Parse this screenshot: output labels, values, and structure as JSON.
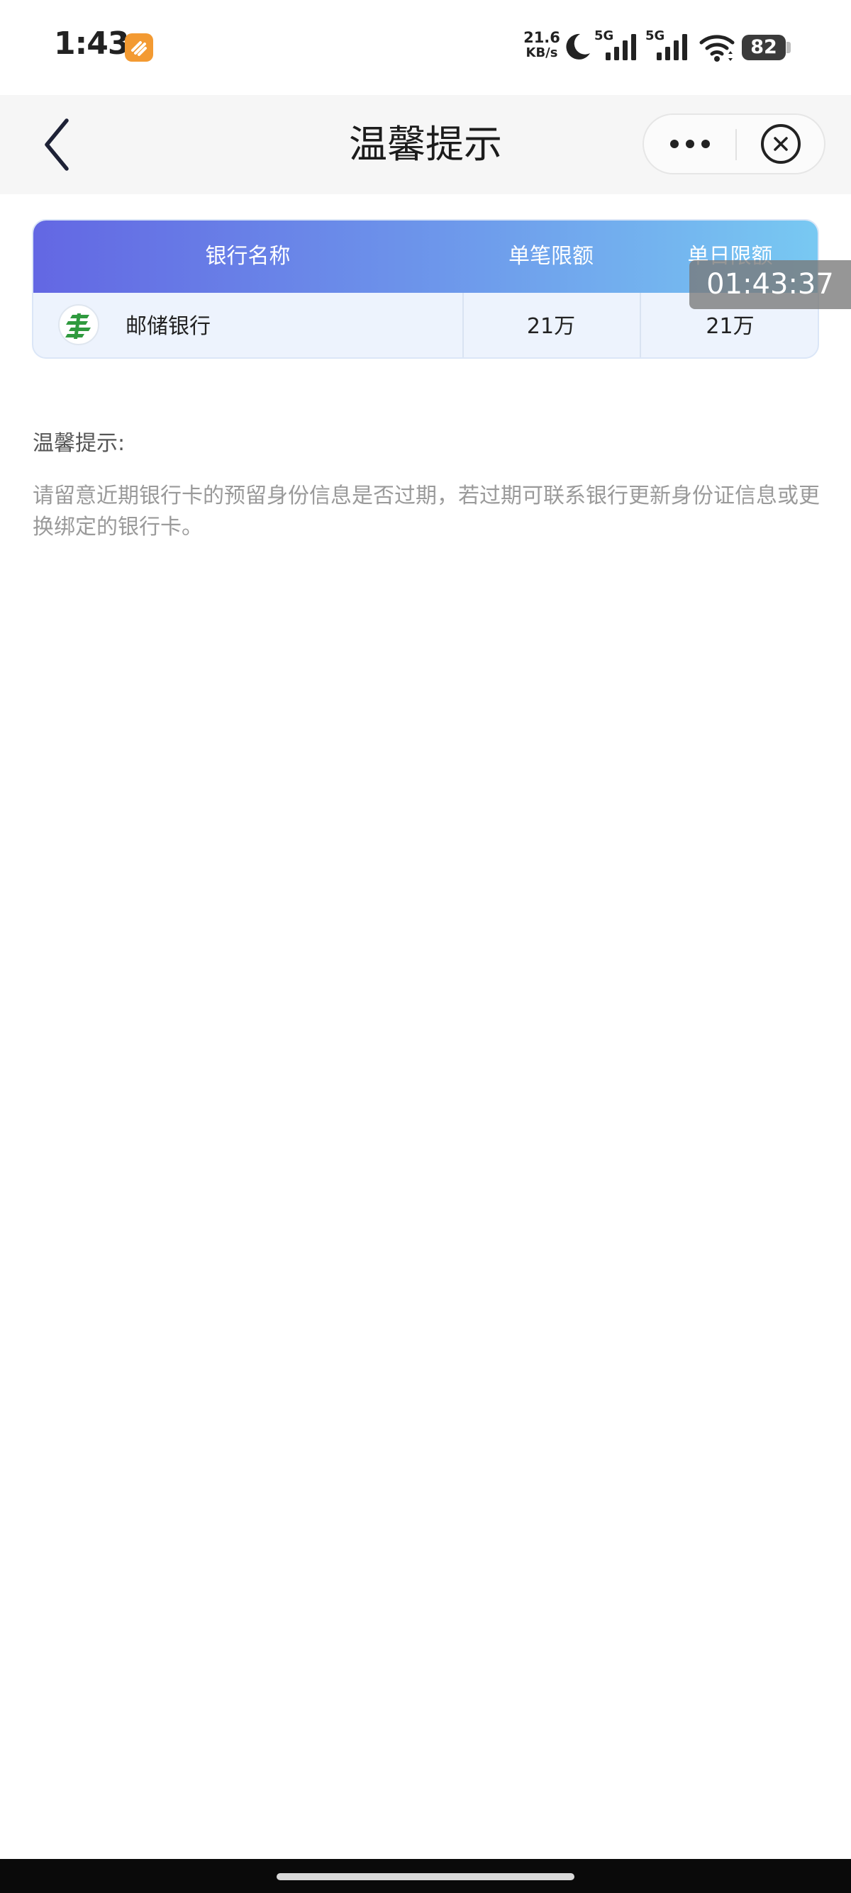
{
  "status_bar": {
    "time": "1:43",
    "net_speed": "21.6",
    "net_unit": "KB/s",
    "sim1_type": "5G",
    "sim2_type": "5G",
    "battery": "82",
    "icons": [
      "app-notification-icon",
      "moon-icon",
      "signal-icon",
      "signal-icon",
      "wifi-icon",
      "battery-icon"
    ]
  },
  "nav": {
    "title": "温馨提示",
    "icons": [
      "back-arrow-icon",
      "more-dots-icon",
      "close-circle-icon"
    ]
  },
  "table": {
    "headers": [
      "银行名称",
      "单笔限额",
      "单日限额"
    ],
    "rows": [
      {
        "bank": "邮储银行",
        "single_limit": "21万",
        "daily_limit": "21万",
        "logo_icon": "postal-bank-logo-icon"
      }
    ],
    "colors": {
      "header_start": "#6367e3",
      "header_end": "#78c9f2",
      "row_bg": "#edf3fd"
    }
  },
  "timer_overlay": "01:43:37",
  "notes": {
    "title": "温馨提示:",
    "text": "请留意近期银行卡的预留身份信息是否过期，若过期可联系银行更新身份证信息或更换绑定的银行卡。"
  }
}
